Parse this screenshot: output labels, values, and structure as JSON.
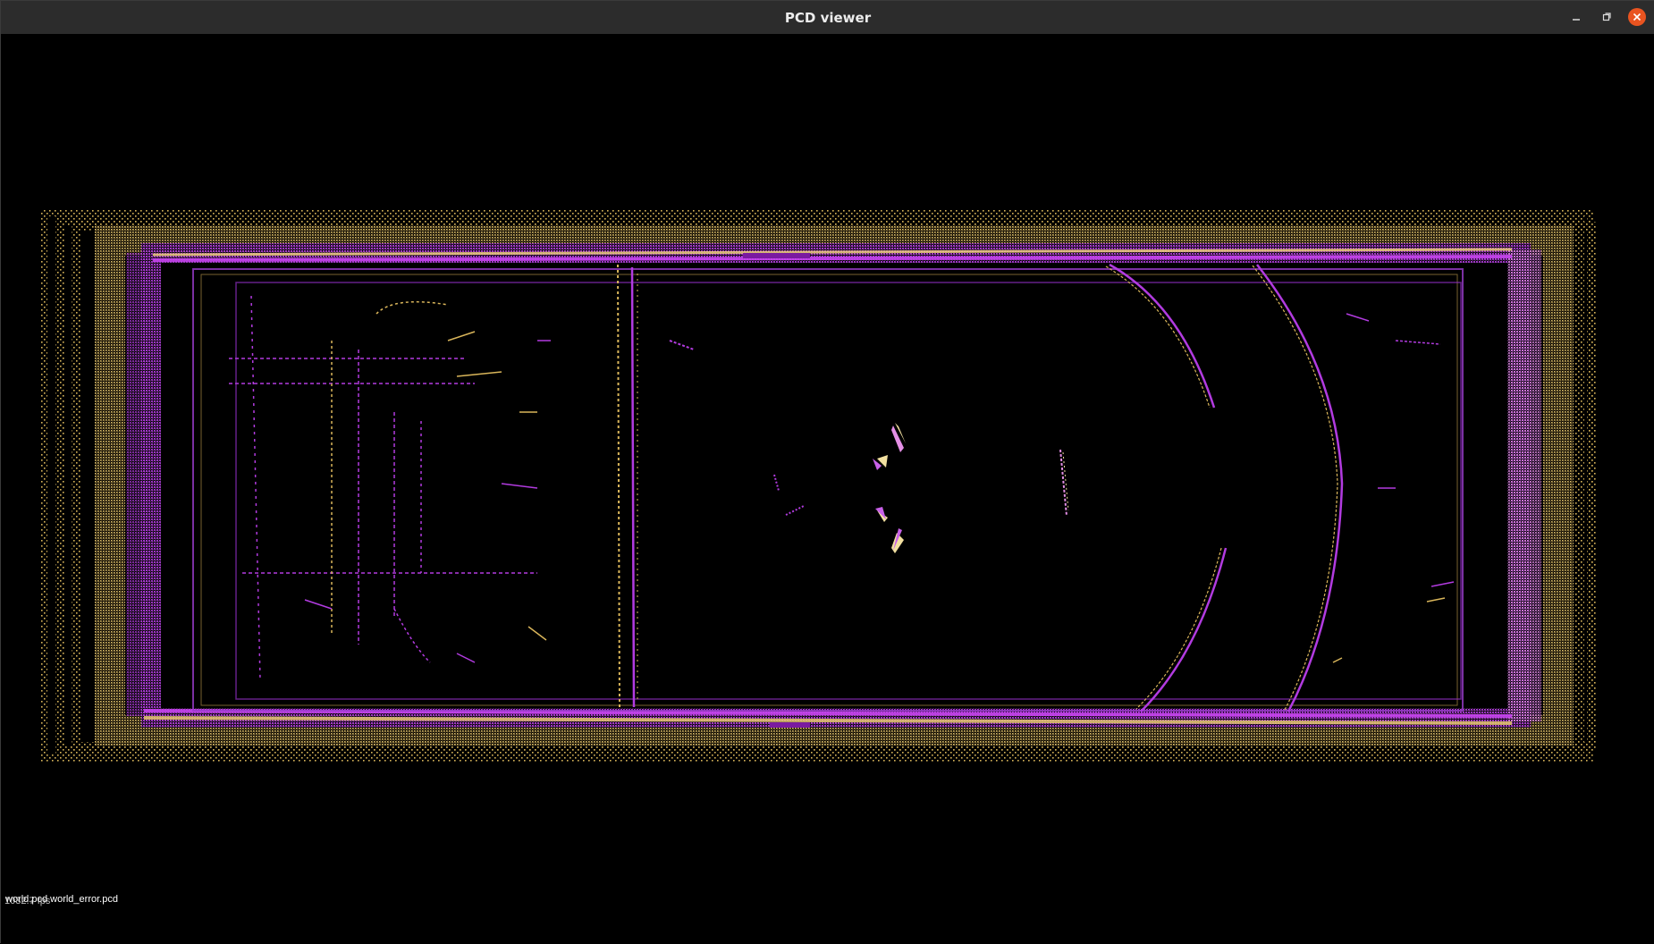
{
  "window": {
    "title": "PCD viewer"
  },
  "controls": {
    "minimize_icon": "minimize-icon",
    "maximize_icon": "maximize-icon",
    "close_icon": "close-icon"
  },
  "viewer": {
    "background": "#000000",
    "clouds": [
      {
        "file": "world.pcd",
        "color": "#d9b55a"
      },
      {
        "file": "world_error.pcd",
        "color": "#b23be0"
      }
    ],
    "filenames_label": "world.pcd world_error.pcd",
    "fps_label": "1032.7 fps"
  }
}
